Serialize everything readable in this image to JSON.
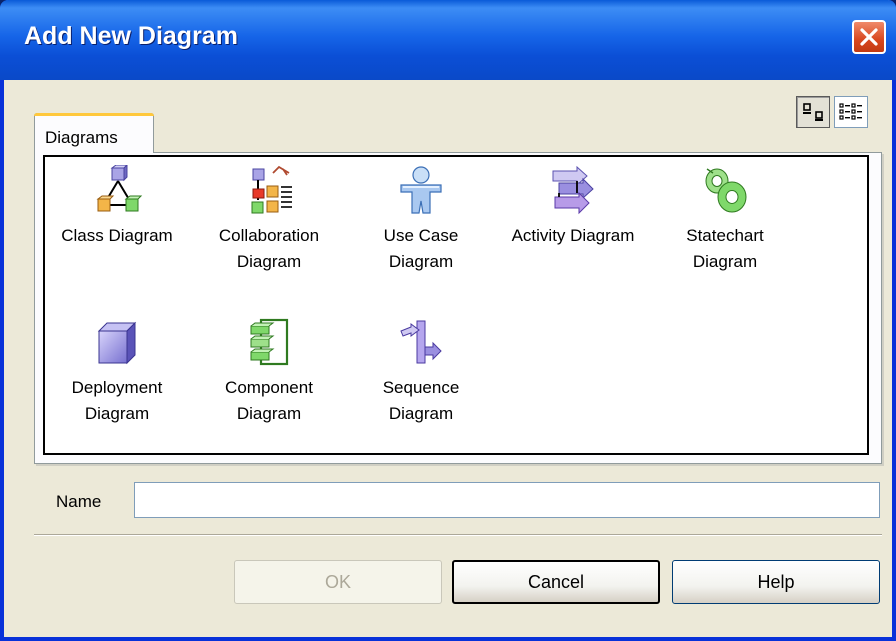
{
  "window": {
    "title": "Add New Diagram"
  },
  "tabs": [
    {
      "label": "Diagrams"
    }
  ],
  "view_buttons": [
    {
      "name": "large-icons-view-button",
      "icon": "large-icons-view-icon",
      "active": true
    },
    {
      "name": "list-view-button",
      "icon": "list-view-icon",
      "active": false
    }
  ],
  "diagrams": [
    {
      "label": "Class Diagram",
      "icon": "class-diagram-icon"
    },
    {
      "label": "Collaboration Diagram",
      "icon": "collaboration-diagram-icon"
    },
    {
      "label": "Use Case Diagram",
      "icon": "use-case-diagram-icon"
    },
    {
      "label": "Activity Diagram",
      "icon": "activity-diagram-icon"
    },
    {
      "label": "Statechart Diagram",
      "icon": "statechart-diagram-icon"
    },
    {
      "label": "Deployment Diagram",
      "icon": "deployment-diagram-icon"
    },
    {
      "label": "Component Diagram",
      "icon": "component-diagram-icon"
    },
    {
      "label": "Sequence Diagram",
      "icon": "sequence-diagram-icon"
    }
  ],
  "name_field": {
    "label": "Name",
    "value": ""
  },
  "buttons": {
    "ok": "OK",
    "cancel": "Cancel",
    "help": "Help"
  }
}
